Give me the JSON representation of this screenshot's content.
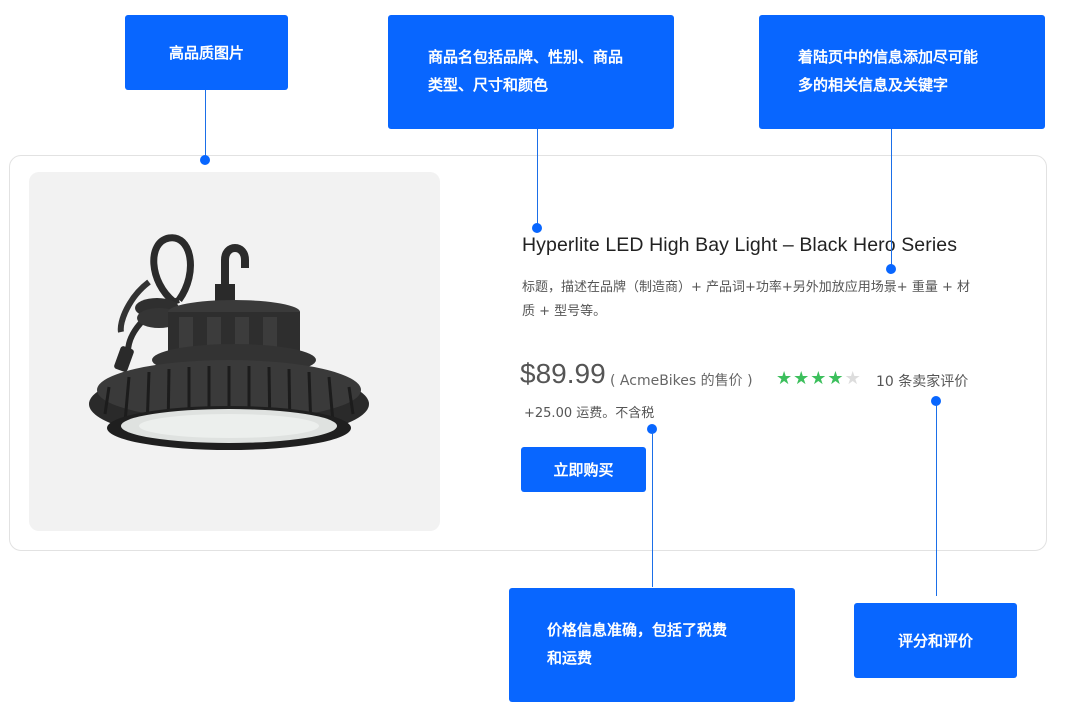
{
  "callouts": {
    "image_quality": "高品质图片",
    "name_line1": "商品名包括品牌、性别、商品",
    "name_line2": "类型、尺寸和颜色",
    "landing_line1": "着陆页中的信息添加尽可能",
    "landing_line2": "多的相关信息及关键字",
    "price_line1": "价格信息准确，包括了税费",
    "price_line2": "和运费",
    "rating": "评分和评价"
  },
  "product": {
    "title": "Hyperlite LED High Bay Light – Black Hero Series",
    "description": "标题，描述在品牌（制造商）+ 产品词+功率+另外加放应用场景+ 重量 + 材质 + 型号等。",
    "price": "$89.99",
    "seller": "( AcmeBikes 的售价 )",
    "rating": 4,
    "rating_max": 5,
    "reviews": "10 条卖家评价",
    "shipping": "+25.00 运费。不含税",
    "buy_label": "立即购买",
    "image": "led-high-bay-light-image"
  },
  "colors": {
    "accent": "#0866ff",
    "star": "#3cbf5c",
    "star_empty": "#dddddd"
  }
}
